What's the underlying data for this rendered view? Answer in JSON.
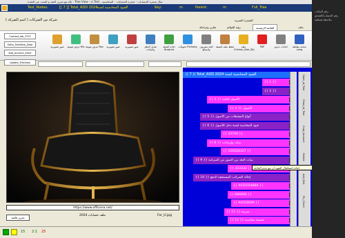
{
  "window": {
    "title": "بالة مع تحرير العقد و البحث عن العقدة - Tree View - انا Test ، مثال شجرة الحسابات - شجرة الحسابات - المحاسبية",
    "test_nodes_label": "Test_Nodes:",
    "test_nodes_value": "[[ 7 ]] Total_ADD 2024",
    "accounts_caption": "القيود المحاسبية لسنة",
    "key_label": "Key:",
    "key_value": "m",
    "parent_label": "Parent:",
    "parent_value": "m",
    "full_tree": "Full_Tree",
    "company_name": "شركة من الشركات ( اسم الشركة )",
    "tree_tab_label": "الشجرة الشبرية"
  },
  "ribbon": {
    "tabs": [
      "ملف",
      "القائمة الرئيسية",
      "رؤية القوائم",
      "تقارير ومراحلة"
    ],
    "active_tab": "القائمة الرئيسية",
    "buttons": [
      {
        "label": "شاشة مطابقة\nLong",
        "icon": "monitor-icon",
        "color": "#3060c0"
      },
      {
        "label": "اعادات عرض",
        "icon": "gear-icon",
        "color": "#808080"
      },
      {
        "label": "PDF",
        "icon": "pdf-icon",
        "color": "#e02020"
      },
      {
        "label": "ملف\nCrinnon_Dxe_Zip",
        "icon": "folder-icon",
        "color": "#e8b020"
      },
      {
        "label": "ضغط ملف\nكصيغة",
        "icon": "archive-icon",
        "color": "#c08040"
      },
      {
        "label": "كتابة مصروف\nوالمبالغ",
        "icon": "note-icon",
        "color": "#808080"
      },
      {
        "label": "تحويلات\nFlichang",
        "icon": "globe-icon",
        "color": "#3090e0"
      },
      {
        "label": "اعادة التعبئة\nDropList",
        "icon": "clipboard-icon",
        "color": "#40a040"
      },
      {
        "label": "تعديل الحقل\nوالبيانات",
        "icon": "edit-icon",
        "color": "#4080c0"
      },
      {
        "label": "صور تصويرية",
        "icon": "photo-icon",
        "color": "#c04040"
      },
      {
        "label": "صور تصويرية",
        "icon": "photo-icon",
        "color": "#40a0c0"
      },
      {
        "label": "عرض صوتية\nRev",
        "icon": "image-icon",
        "color": "#c09040"
      },
      {
        "label": "عرض صوتية\nFile",
        "icon": "image-icon",
        "color": "#40c080"
      },
      {
        "label": "صور تصويرية",
        "icon": "photo-icon",
        "color": "#e0a030"
      }
    ]
  },
  "side_buttons": [
    "Context_dib_YYYY",
    "Edita_TreeView_Data",
    "Add_Account_Emer",
    "Update_Treeview"
  ],
  "tree": {
    "header": "(( 7 )) Total_ADD 2024 القيود المحاسبية لسنة",
    "rows": [
      {
        "text": "{{ 1 }}",
        "color": "pink"
      },
      {
        "text": "{{ 2 }}",
        "color": "purple"
      },
      {
        "text": "{{ 3 }} الأصول الثابتة",
        "color": "pink"
      },
      {
        "text": "{{ 4 }} الأصول",
        "color": "pink"
      },
      {
        "text": "{{ 5 }} أنواع المشتقات من الأصول",
        "color": "purple"
      },
      {
        "text": "{{ 6 }} قيود المحاسبة لسنة دخل للأصول",
        "color": "purple"
      },
      {
        "text": "{{ 33749 }}",
        "color": "pink"
      },
      {
        "text": "{{ 8 }} بنيات وإيرادات",
        "color": "pink"
      },
      {
        "text": "{{ 326628327 }}",
        "color": "pink"
      },
      {
        "text": "{{ 9 }} بنيات البعد بين الصور من الميزانية",
        "color": "purple"
      },
      {
        "text": "{{ 333333 }}",
        "color": "pink"
      },
      {
        "text": "{{ 10 }} إحالة الضرائب المستحقة الدفع",
        "color": "purple"
      },
      {
        "text": "{{ 4435554888 }}",
        "color": "pink"
      },
      {
        "text": "{{ 666666 }}",
        "color": "pink"
      },
      {
        "text": "{{ 94554699 }}",
        "color": "pink"
      },
      {
        "text": "{{ 11 }} ضريبة",
        "color": "pink"
      },
      {
        "text": "{{ 12 }} قسمة محاسبة",
        "color": "pink"
      }
    ]
  },
  "tooltip": "إعادة استكمال القيود ان مع عدم الحاجة",
  "strip_labels": [
    "Open_al_Tree",
    "Close_al_Tree",
    "Copy_Account",
    "Delete",
    "Add_Edit",
    "Pic_Client"
  ],
  "image": {
    "url": "https://www.officena.net/",
    "file_name": "For_U.jpg",
    "caption": "ملف حسابات 2024",
    "edit_button": "تحرير قائمة"
  },
  "status": {
    "a": "15",
    "b": "2:1",
    "c": "25"
  },
  "right_panel": {
    "lines": [
      "رقم البيانات",
      "رقم الحساب/العقدي",
      "ملاحظة إضافية"
    ]
  }
}
